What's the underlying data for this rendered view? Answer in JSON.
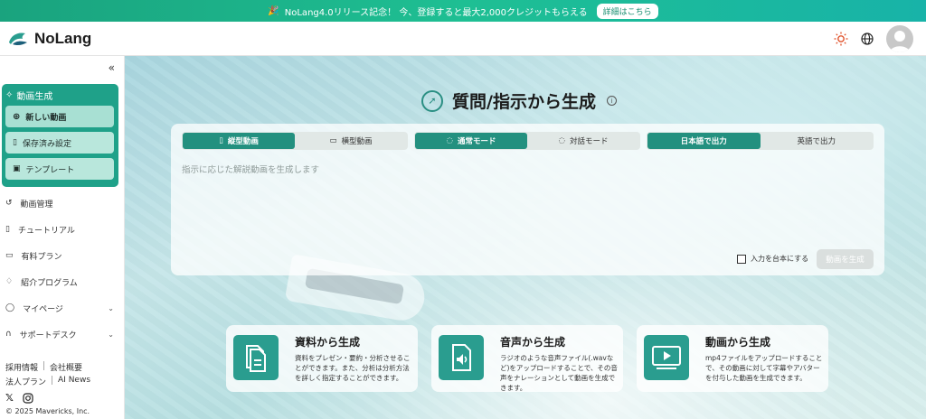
{
  "banner": {
    "text": "NoLang4.0リリース記念！ 今、登録すると最大2,000クレジットもらえる",
    "button": "詳細はこちら"
  },
  "header": {
    "logo_text": "NoLang",
    "icons": [
      "sun-icon",
      "globe-icon",
      "avatar"
    ]
  },
  "sidebar": {
    "collapse_icon": "double-chevron-left",
    "group_title": "動画生成",
    "group_items": [
      {
        "label": "新しい動画",
        "icon": "plus-circle-icon"
      },
      {
        "label": "保存済み設定",
        "icon": "bookmark-icon"
      },
      {
        "label": "テンプレート",
        "icon": "image-icon"
      }
    ],
    "nav_items": [
      {
        "label": "動画管理",
        "icon": "history-icon"
      },
      {
        "label": "チュートリアル",
        "icon": "book-icon"
      },
      {
        "label": "有料プラン",
        "icon": "card-icon"
      },
      {
        "label": "紹介プログラム",
        "icon": "handshake-icon"
      },
      {
        "label": "マイページ",
        "icon": "user-icon"
      },
      {
        "label": "サポートデスク",
        "icon": "headset-icon"
      }
    ],
    "footer": {
      "row1": [
        "採用情報",
        "会社概要"
      ],
      "row2": [
        "法人プラン",
        "AI News"
      ],
      "copyright": "© 2025 Mavericks, Inc."
    }
  },
  "main": {
    "title": "質問/指示から生成",
    "toggles": {
      "orientation": [
        "縦型動画",
        "横型動画"
      ],
      "mode": [
        "通常モード",
        "対話モード"
      ],
      "language": [
        "日本語で出力",
        "英語で出力"
      ]
    },
    "placeholder": "指示に応じた解説動画を生成します",
    "checkbox_label": "入力を台本にする",
    "generate_button": "動画を生成",
    "cards": [
      {
        "title": "資料から生成",
        "desc": "資料をプレゼン・要約・分析させることができます。また、分析は分析方法を詳しく指定することができます。"
      },
      {
        "title": "音声から生成",
        "desc": "ラジオのような音声ファイル(.wavなど)をアップロードすることで、その音声をナレーションとして動画を生成できます。"
      },
      {
        "title": "動画から生成",
        "desc": "mp4ファイルをアップロードすることで、その動画に対して字幕やアバターを付与した動画を生成できます。"
      }
    ]
  },
  "colors": {
    "accent": "#23907f",
    "banner": "#1ebf93",
    "sidebar_group": "#1fa189"
  }
}
